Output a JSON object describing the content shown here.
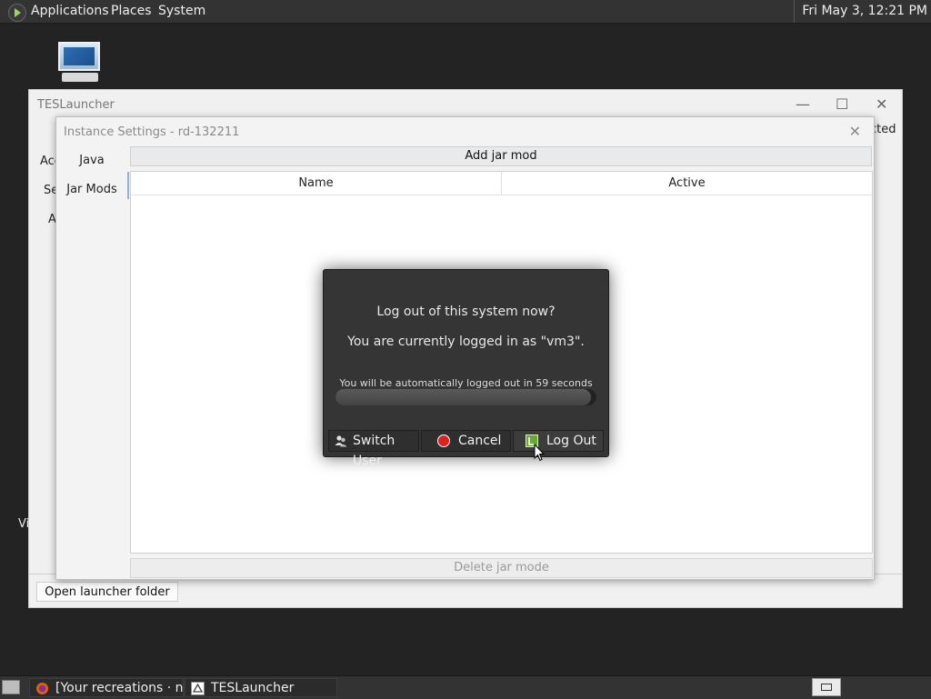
{
  "top_panel": {
    "menus": [
      "Applications",
      "Places",
      "System"
    ],
    "clock": "Fri May 3, 12:21 PM"
  },
  "launcher": {
    "title": "TESLauncher",
    "partial_labels": [
      "Acc",
      "Se",
      "A",
      "Vi"
    ],
    "partial_right": "cted",
    "open_folder_label": "Open launcher folder",
    "controls": {
      "minimize": "—",
      "maximize": "☐",
      "close": "✕"
    }
  },
  "instance": {
    "title": "Instance Settings - rd-132211",
    "sidebar": [
      "Java",
      "Jar Mods"
    ],
    "add_jar_label": "Add jar mod",
    "columns": [
      "Name",
      "Active"
    ],
    "delete_jar_label": "Delete jar mode",
    "close": "✕"
  },
  "logout": {
    "question": "Log out of this system now?",
    "logged_in_as": "You are currently logged in as \"vm3\".",
    "auto_message": "You will be automatically logged out in 59 seconds",
    "progress_fraction": 0.98,
    "buttons": {
      "switch_user": "Switch User",
      "cancel": "Cancel",
      "log_out": "Log Out"
    }
  },
  "taskbar": {
    "items": [
      "[Your recreations · n…",
      "TESLauncher"
    ]
  },
  "colors": {
    "cancel_icon": "#e02020",
    "logout_icon": "#6aa832"
  }
}
